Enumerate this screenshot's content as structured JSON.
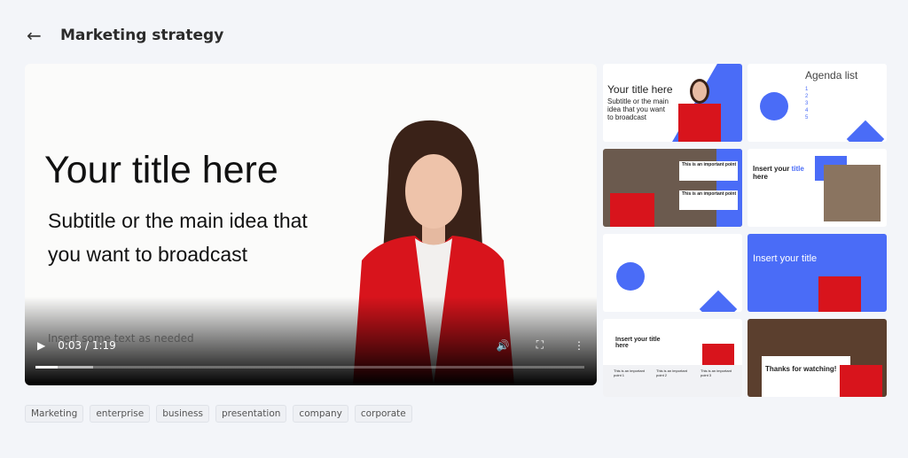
{
  "header": {
    "back_icon": "arrow-left-icon",
    "title": "Marketing strategy"
  },
  "player": {
    "slide_title": "Your title here",
    "slide_subtitle": "Subtitle or the main idea that you want to broadcast",
    "slide_note": "Insert some text as needed",
    "time": "0:03 / 1:19",
    "progress_fraction": 0.04,
    "buffered_fraction": 0.105,
    "play_icon": "play-icon",
    "volume_icon": "volume-icon",
    "fullscreen_icon": "fullscreen-icon",
    "more_icon": "more-vert-icon"
  },
  "thumbnails": [
    {
      "title": "Your title here",
      "subtitle": "Subtitle or the main idea that you want to broadcast"
    },
    {
      "title": "Agenda list",
      "items": [
        "1",
        "2",
        "3",
        "4",
        "5"
      ]
    },
    {
      "title": "This is an important point",
      "title2": "This is an important point"
    },
    {
      "title": "Insert your",
      "accent": "title",
      "rest": "here"
    },
    {
      "title": ""
    },
    {
      "title": "Insert your title"
    },
    {
      "title": "Insert your title here",
      "points": [
        "This is an important point 1",
        "This is an important point 2",
        "This is an important point 3"
      ]
    },
    {
      "title": "Thanks for watching!"
    }
  ],
  "tags": [
    "Marketing",
    "enterprise",
    "business",
    "presentation",
    "company",
    "corporate"
  ],
  "colors": {
    "accent": "#4a6cf7",
    "jacket": "#d8141c",
    "background": "#f3f5f9"
  }
}
